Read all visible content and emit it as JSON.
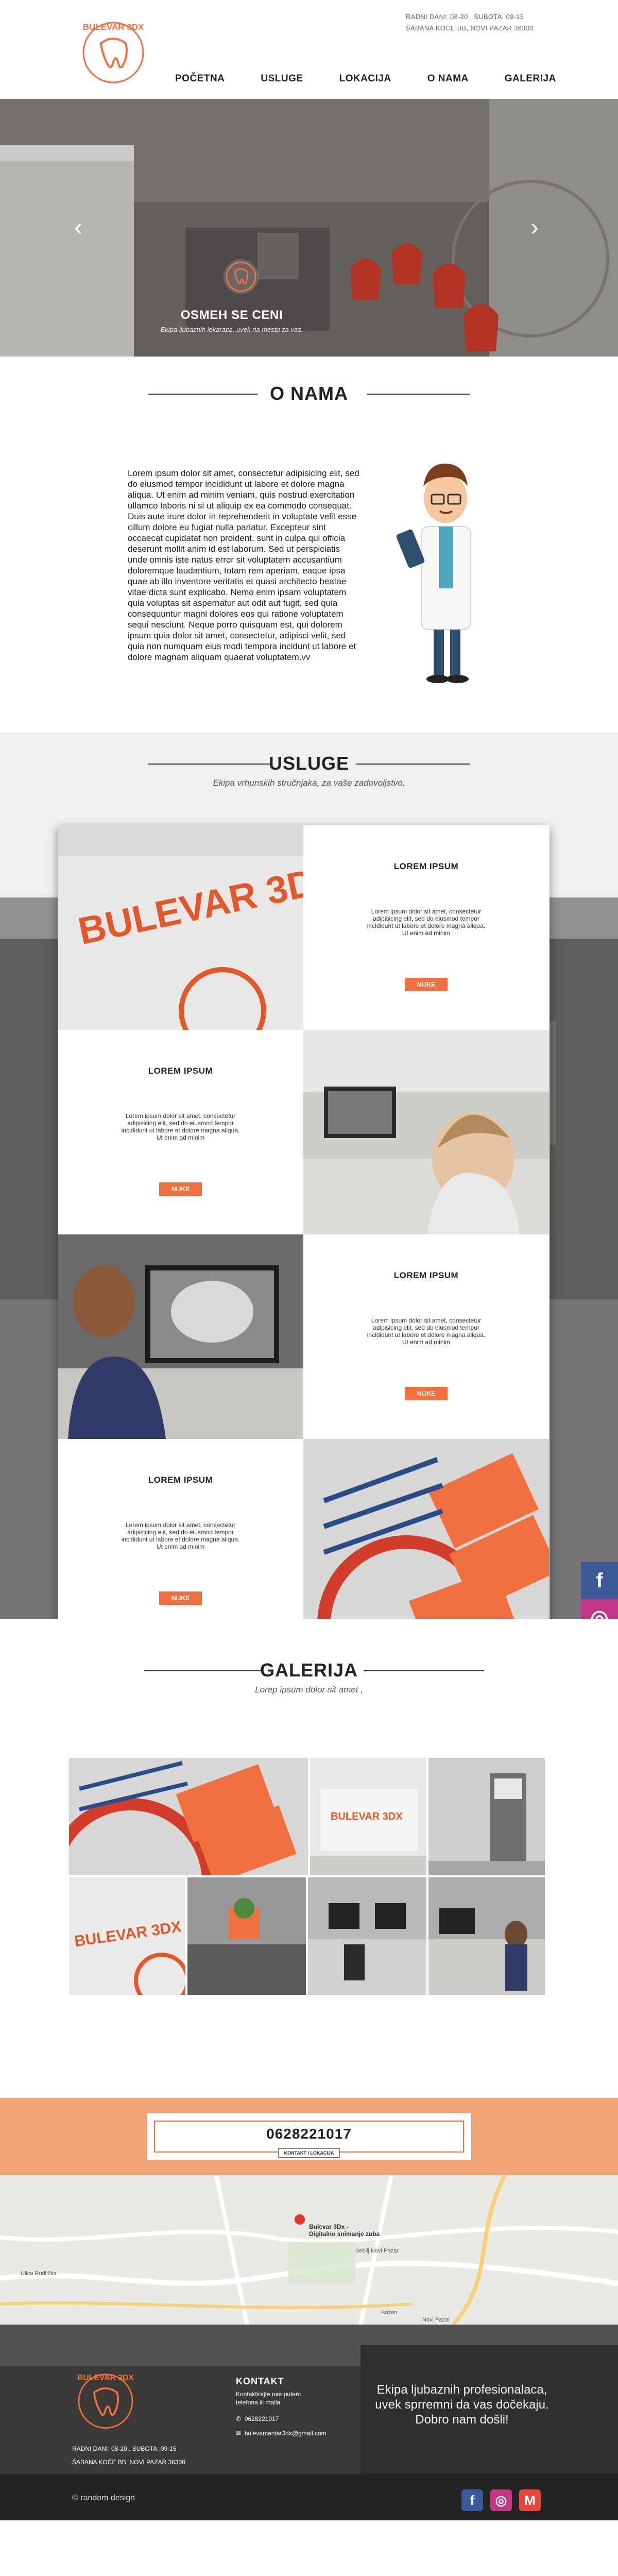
{
  "brand": {
    "name": "BULEVAR 3DX",
    "accent": "#f07040"
  },
  "header": {
    "hours": "RADNI DANI: 08-20 , SUBOTA: 09-15",
    "address": "ŠABANA KOČE BB, NOVI PAZAR 36300",
    "nav": [
      "POČETNA",
      "USLUGE",
      "LOKACIJA",
      "O NAMA",
      "GALERIJA"
    ]
  },
  "hero": {
    "title": "OSMEH SE CENI",
    "subtitle": "Ekipa ljubaznih lekaraca, uvek na mestu za vas.",
    "prev_icon": "chevron-left-icon",
    "next_icon": "chevron-right-icon"
  },
  "about": {
    "title": "O NAMA",
    "text": "Lorem ipsum dolor sit amet, consectetur adipisicing elit, sed do eiusmod tempor incididunt ut labore et dolore magna aliqua. Ut enim ad minim veniam, quis nostrud exercitation ullamco laboris ni si ut aliquip ex ea commodo consequat. Duis aute irure dolor in reprehenderit in voluptate velit esse cillum dolore eu fugiat nulla pariatur. Excepteur sint occaecat cupidatat non proident, sunt in culpa qui officia deserunt mollit anim id est laborum. Sed ut perspiciatis unde omnis iste natus error sit voluptatem accusantium doloremque laudantium, totam rem aperiam, eaque ipsa quae ab illo inventore veritatis et quasi architecto beatae vitae dicta sunt explicabo. Nemo enim ipsam voluptatem quia voluptas sit aspernatur aut odit aut fugit, sed quia consequuntur magni dolores eos qui ratione voluptatem sequi nesciunt. Neque porro quisquam est, qui dolorem ipsum quia dolor sit amet, consectetur, adipisci velit, sed quia non numquam eius modi tempora incidunt ut labore et dolore magnam aliquam quaerat voluptatem.vv"
  },
  "services": {
    "title": "USLUGE",
    "subtitle": "Ekipa vrhunskih stručnjaka, za vaše zadovoljstvo.",
    "cards": [
      {
        "title": "LOREM IPSUM",
        "text": "Lorem ipsum dolor sit amet, consectetur adipisicing elit, sed do eiusmod tempor incididunt ut labore et dolore magna aliqua. Ut enim ad minim",
        "button": "NIJKE"
      },
      {
        "title": "LOREM IPSUM",
        "text": "Lorem ipsum dolor sit amet, consectetur adipisicing elit, sed do eiusmod tempor incididunt ut labore et dolore magna aliqua. Ut enim ad minim",
        "button": "NIJKE"
      },
      {
        "title": "LOREM IPSUM",
        "text": "Lorem ipsum dolor sit amet, consectetur adipisicing elit, sed do eiusmod tempor incididunt ut labore et dolore magna aliqua. Ut enim ad minim",
        "button": "NIJKE"
      },
      {
        "title": "LOREM IPSUM",
        "text": "Lorem ipsum dolor sit amet, consectetur adipisicing elit, sed do eiusmod tempor incididunt ut labore et dolore magna aliqua. Ut enim ad minim",
        "button": "NIJKE"
      }
    ],
    "photo_sign": "BULEVAR 3DX"
  },
  "social": {
    "facebook_icon": "facebook-icon",
    "instagram_icon": "instagram-icon",
    "facebook_label": "f",
    "instagram_label": "◎"
  },
  "gallery": {
    "title": "GALERIJA",
    "subtitle": "Lorep ipsum dolor sit amet ,",
    "sign": "BULEVAR 3DX"
  },
  "phone": {
    "number": "0628221017",
    "button": "KONTAKT I LOKACIJA"
  },
  "map": {
    "marker_label_1": "Bulevar 3Dx -",
    "marker_label_2": "Digitalno snimanje zuba",
    "place_1": "Sebilj Novi Pazar",
    "place_2": "Novi Pazar",
    "place_3": "Ulica Rudlička",
    "place_4": "Bazen"
  },
  "footer": {
    "hours": "RADNI DANI: 08-20 , SUBOTA: 09-15",
    "address": "ŠABANA KOČE BB, NOVI PAZAR 36300",
    "contact_title": "KONTAKT",
    "contact_desc_1": "Kontaktirajte nas putem",
    "contact_desc_2": "telefona ili maila",
    "phone": "0628221017",
    "email": "bulevarcentar3dx@gmail.com",
    "slogan_1": "Ekipa ljubaznih profesionalaca,",
    "slogan_2": "uvek sprremni da vas dočekaju.",
    "slogan_3": "Dobro nam došli!",
    "copyright": "© random design",
    "icons": [
      "facebook-icon",
      "instagram-icon",
      "gmail-icon"
    ],
    "icon_labels": [
      "f",
      "◎",
      "M"
    ]
  }
}
